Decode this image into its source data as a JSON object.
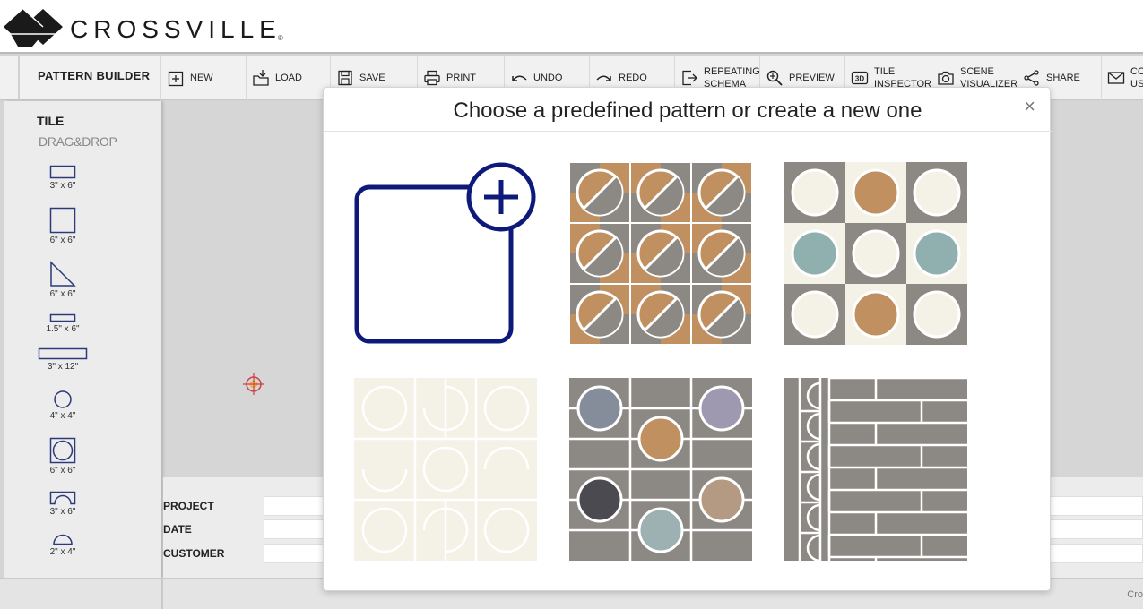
{
  "header": {
    "brand": "CROSSVILLE",
    "reg": "®"
  },
  "toolbar": {
    "title": "PATTERN BUILDER",
    "buttons": [
      {
        "label": "NEW",
        "icon": "new-icon"
      },
      {
        "label": "LOAD",
        "icon": "load-icon"
      },
      {
        "label": "SAVE",
        "icon": "save-icon"
      },
      {
        "label": "PRINT",
        "icon": "print-icon"
      },
      {
        "label": "UNDO",
        "icon": "undo-icon"
      },
      {
        "label": "REDO",
        "icon": "redo-icon"
      },
      {
        "label_line1": "REPEATING",
        "label_line2": "SCHEMA",
        "icon": "repeating-schema-icon"
      },
      {
        "label": "PREVIEW",
        "icon": "preview-icon"
      },
      {
        "label_line1": "TILE",
        "label_line2": "INSPECTOR",
        "icon": "tile-inspector-3d-icon"
      },
      {
        "label_line1": "SCENE",
        "label_line2": "VISUALIZER",
        "icon": "camera-icon"
      },
      {
        "label": "SHARE",
        "icon": "share-icon"
      },
      {
        "label_line1": "CO",
        "label_line2": "US",
        "icon": "mail-icon"
      }
    ]
  },
  "left_panel": {
    "title": "TILE",
    "subtitle": "DRAG&DROP",
    "tiles": [
      {
        "label": "3\" x 6\"",
        "shape": "rectangle"
      },
      {
        "label": "6\" x 6\"",
        "shape": "square"
      },
      {
        "label": "6\" x 6\"",
        "shape": "triangle"
      },
      {
        "label": "1.5\" x 6\"",
        "shape": "thin-rectangle"
      },
      {
        "label": "3\" x 12\"",
        "shape": "long-rectangle"
      },
      {
        "label": "4\" x 4\"",
        "shape": "circle"
      },
      {
        "label": "6\" x 6\"",
        "shape": "square-with-circle"
      },
      {
        "label": "3\" x 6\"",
        "shape": "arch"
      },
      {
        "label": "2\" x 4\"",
        "shape": "half-circle"
      }
    ]
  },
  "info": {
    "project_label": "PROJECT",
    "date_label": "DATE",
    "customer_label": "CUSTOMER",
    "project_value": "",
    "date_value": "",
    "customer_value": ""
  },
  "footer": {
    "text": "Cro"
  },
  "modal": {
    "title": "Choose a predefined pattern or create a new one",
    "close": "×",
    "patterns": [
      {
        "name": "create-new-pattern",
        "icon": "plus-icon"
      },
      {
        "name": "circle-slash-terracotta-grey"
      },
      {
        "name": "circles-cream-grey-terracotta-teal"
      },
      {
        "name": "cream-circles-and-arches"
      },
      {
        "name": "grey-tiles-colored-circles"
      },
      {
        "name": "grey-brick-with-arches"
      }
    ]
  },
  "colors": {
    "navy": "#0d1a7a",
    "terracotta": "#c09060",
    "grey": "#8c8984",
    "cream": "#f4f1e7",
    "teal": "#8fb0ae",
    "slate": "#858d9a",
    "lilac": "#9e98b0",
    "charcoal": "#4a4a50",
    "sand": "#b49a82",
    "seafoam": "#9db1b2"
  }
}
